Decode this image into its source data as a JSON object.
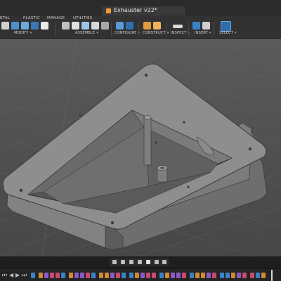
{
  "window": {
    "document_title": "Exhauster v22*"
  },
  "ribbon": {
    "tabs": [
      {
        "label": "ETAL"
      },
      {
        "label": "PLASTIC"
      },
      {
        "label": "MANAGE"
      },
      {
        "label": "UTILITIES"
      }
    ],
    "groups": [
      {
        "label": "MODIFY"
      },
      {
        "label": "ASSEMBLE"
      },
      {
        "label": "CONFIGURE"
      },
      {
        "label": "CONSTRUCT"
      },
      {
        "label": "INSPECT"
      },
      {
        "label": "INSERT"
      },
      {
        "label": "SELECT"
      }
    ],
    "dropdown_glyph": "▾"
  },
  "navbar": {
    "icons": [
      "orbit-icon",
      "pan-icon",
      "zoom-icon",
      "fit-icon",
      "display-settings-icon",
      "grid-icon",
      "viewports-icon"
    ]
  },
  "timeline": {
    "controls": [
      "⏮",
      "◀",
      "▶",
      "⏭"
    ],
    "feature_colors": [
      "#3a82c8",
      "#c84a6c",
      "#8a5ac8",
      "#d28a32"
    ]
  },
  "colors": {
    "ribbon_bg": "#323232",
    "viewport_top": "#5a5a5a",
    "viewport_bottom": "#474747",
    "body_face": "#7c7c7c",
    "body_dark": "#555555",
    "top_face": "#8e8e8e",
    "select_blue": "#3a82c8"
  }
}
